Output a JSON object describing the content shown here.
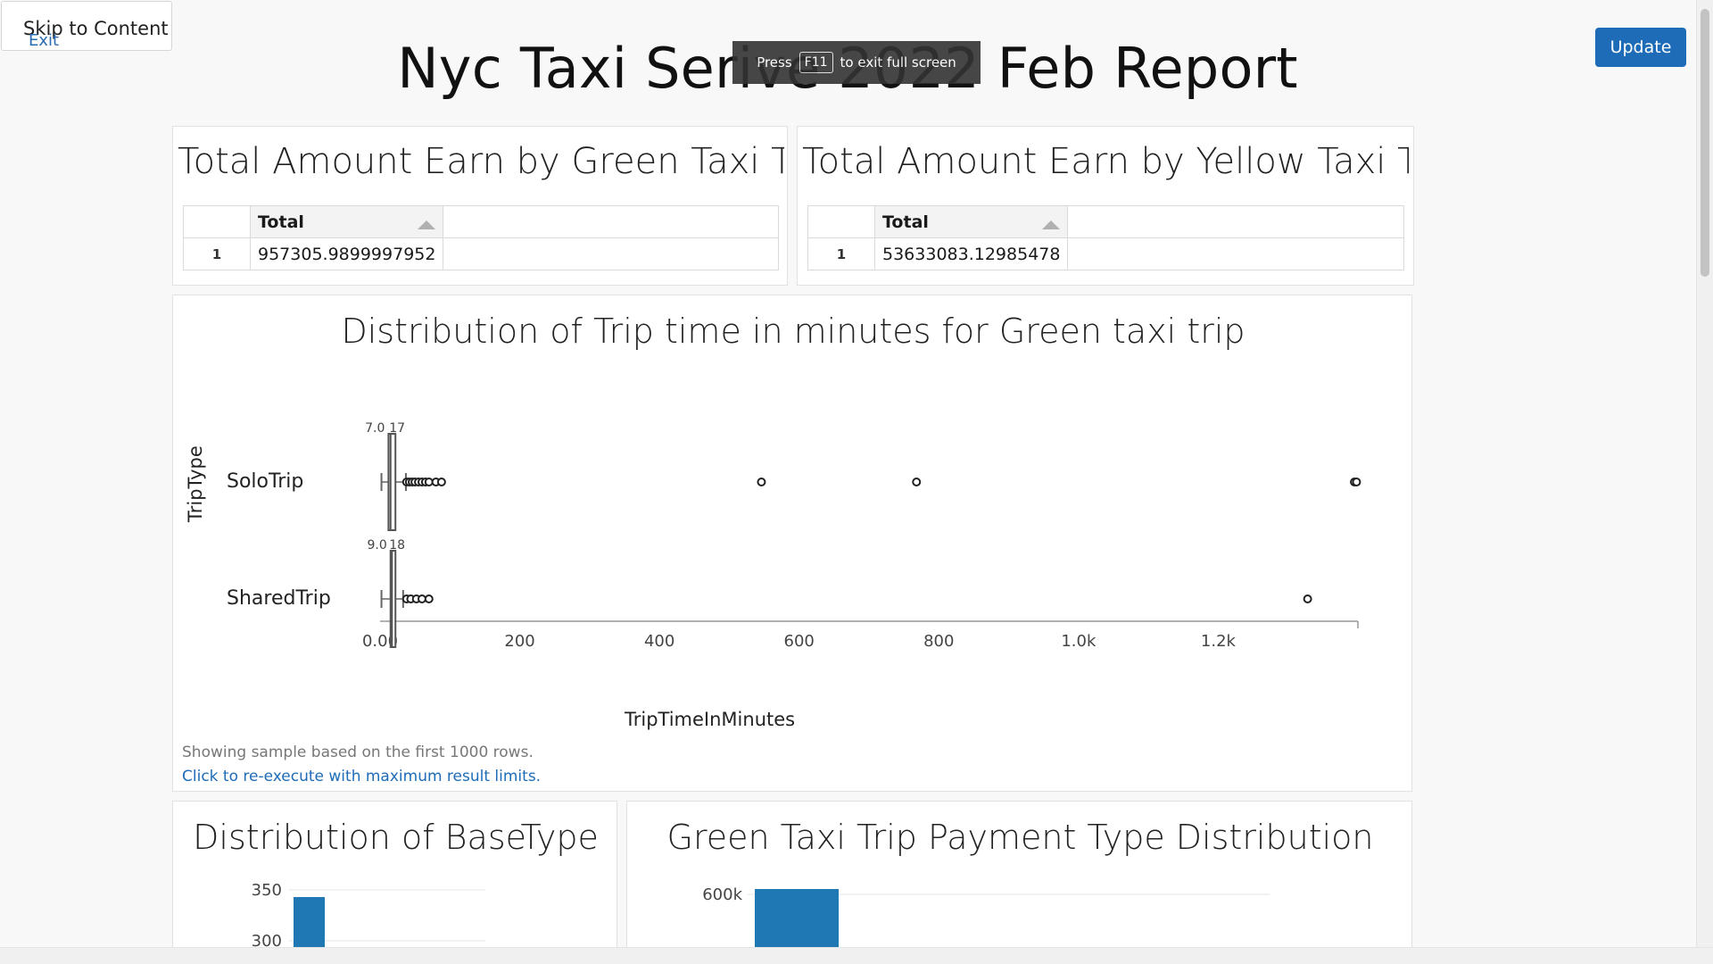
{
  "skip_link": {
    "label": "Skip to Content",
    "exit_label": "Exit"
  },
  "page_title": "Nyc Taxi Serive 2022 Feb Report",
  "fullscreen_banner": {
    "press": "Press",
    "key": "F11",
    "suffix": "to exit full screen"
  },
  "update_button": "Update",
  "green_table": {
    "title": "Total Amount Earn by Green Taxi Trip...",
    "column": "Total",
    "rows": [
      {
        "index": "1",
        "total": "957305.9899997952"
      }
    ]
  },
  "yellow_table": {
    "title": "Total Amount Earn by Yellow Taxi Trip...",
    "column": "Total",
    "rows": [
      {
        "index": "1",
        "total": "53633083.12985478"
      }
    ]
  },
  "boxplot_panel": {
    "note": "Showing sample based on the first 1000 rows.",
    "link": "Click to re-execute with maximum result limits."
  },
  "chart_data": [
    {
      "type": "boxplot",
      "title": "Distribution of Trip time in minutes for Green taxi trip",
      "xlabel": "TripTimeInMinutes",
      "ylabel": "TripType",
      "xlim": [
        0,
        1400
      ],
      "x_ticks": [
        "0.00",
        "200",
        "400",
        "600",
        "800",
        "1.0k",
        "1.2k"
      ],
      "x_tick_values": [
        0,
        200,
        400,
        600,
        800,
        1000,
        1200
      ],
      "series": [
        {
          "name": "SoloTrip",
          "min": 2,
          "q1": 12,
          "median": 15,
          "q3": 22,
          "max": 37,
          "q1_label": "7.0",
          "q3_label": "17",
          "outliers": [
            38,
            42,
            46,
            50,
            55,
            60,
            65,
            70,
            80,
            88,
            546,
            768,
            1395,
            1398
          ]
        },
        {
          "name": "SharedTrip",
          "min": 2,
          "q1": 15,
          "median": 17,
          "q3": 22,
          "max": 33,
          "q1_label": "9.0",
          "q3_label": "18",
          "outliers": [
            38,
            44,
            52,
            60,
            70,
            1328
          ]
        }
      ]
    },
    {
      "type": "bar",
      "title": "Distribution of BaseType",
      "y_ticks": [
        "350",
        "300"
      ],
      "y_tick_values": [
        350,
        300
      ],
      "values": [
        343
      ]
    },
    {
      "type": "bar",
      "title": "Green Taxi Trip Payment Type Distribution",
      "y_ticks": [
        "600k"
      ],
      "y_tick_values": [
        600000
      ],
      "values": [
        600000
      ]
    }
  ]
}
